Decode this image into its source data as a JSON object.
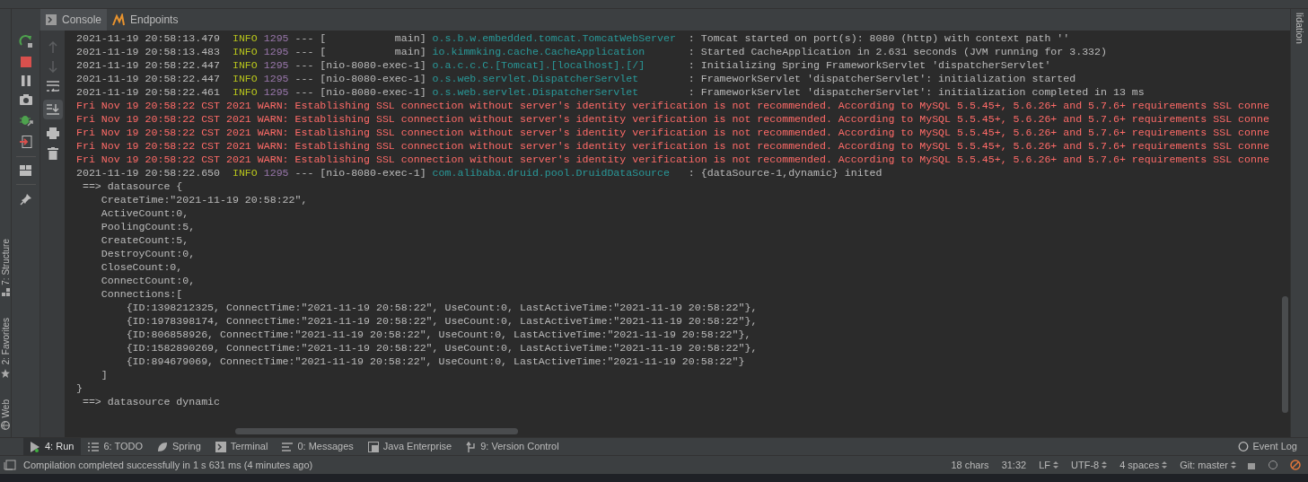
{
  "console_tabs": [
    {
      "label": "Console",
      "selected": true
    },
    {
      "label": "Endpoints",
      "selected": false
    }
  ],
  "side_tabs": [
    {
      "label": "7: Structure"
    },
    {
      "label": "2: Favorites"
    },
    {
      "label": "Web"
    }
  ],
  "right_tab": "lidation",
  "log_lines": [
    {
      "kind": "info",
      "timestamp": "2021-11-19 20:58:13.479",
      "level": "INFO",
      "pid": "1295",
      "sep": "---",
      "thread": "[           main]",
      "logger": "o.s.b.w.embedded.tomcat.TomcatWebServer",
      "message": ": Tomcat started on port(s): 8080 (http) with context path ''"
    },
    {
      "kind": "info",
      "timestamp": "2021-11-19 20:58:13.483",
      "level": "INFO",
      "pid": "1295",
      "sep": "---",
      "thread": "[           main]",
      "logger": "io.kimmking.cache.CacheApplication",
      "message": ": Started CacheApplication in 2.631 seconds (JVM running for 3.332)"
    },
    {
      "kind": "info",
      "timestamp": "2021-11-19 20:58:22.447",
      "level": "INFO",
      "pid": "1295",
      "sep": "---",
      "thread": "[nio-8080-exec-1]",
      "logger": "o.a.c.c.C.[Tomcat].[localhost].[/]",
      "message": ": Initializing Spring FrameworkServlet 'dispatcherServlet'"
    },
    {
      "kind": "info",
      "timestamp": "2021-11-19 20:58:22.447",
      "level": "INFO",
      "pid": "1295",
      "sep": "---",
      "thread": "[nio-8080-exec-1]",
      "logger": "o.s.web.servlet.DispatcherServlet",
      "message": ": FrameworkServlet 'dispatcherServlet': initialization started"
    },
    {
      "kind": "info",
      "timestamp": "2021-11-19 20:58:22.461",
      "level": "INFO",
      "pid": "1295",
      "sep": "---",
      "thread": "[nio-8080-exec-1]",
      "logger": "o.s.web.servlet.DispatcherServlet",
      "message": ": FrameworkServlet 'dispatcherServlet': initialization completed in 13 ms"
    },
    {
      "kind": "warn",
      "text": "Fri Nov 19 20:58:22 CST 2021 WARN: Establishing SSL connection without server's identity verification is not recommended. According to MySQL 5.5.45+, 5.6.26+ and 5.7.6+ requirements SSL conne"
    },
    {
      "kind": "warn",
      "text": "Fri Nov 19 20:58:22 CST 2021 WARN: Establishing SSL connection without server's identity verification is not recommended. According to MySQL 5.5.45+, 5.6.26+ and 5.7.6+ requirements SSL conne"
    },
    {
      "kind": "warn",
      "text": "Fri Nov 19 20:58:22 CST 2021 WARN: Establishing SSL connection without server's identity verification is not recommended. According to MySQL 5.5.45+, 5.6.26+ and 5.7.6+ requirements SSL conne"
    },
    {
      "kind": "warn",
      "text": "Fri Nov 19 20:58:22 CST 2021 WARN: Establishing SSL connection without server's identity verification is not recommended. According to MySQL 5.5.45+, 5.6.26+ and 5.7.6+ requirements SSL conne"
    },
    {
      "kind": "warn",
      "text": "Fri Nov 19 20:58:22 CST 2021 WARN: Establishing SSL connection without server's identity verification is not recommended. According to MySQL 5.5.45+, 5.6.26+ and 5.7.6+ requirements SSL conne"
    },
    {
      "kind": "info",
      "timestamp": "2021-11-19 20:58:22.650",
      "level": "INFO",
      "pid": "1295",
      "sep": "---",
      "thread": "[nio-8080-exec-1]",
      "logger": "com.alibaba.druid.pool.DruidDataSource",
      "message": ": {dataSource-1,dynamic} inited"
    },
    {
      "kind": "plain",
      "text": " ==> datasource {"
    },
    {
      "kind": "plain",
      "text": "    CreateTime:\"2021-11-19 20:58:22\","
    },
    {
      "kind": "plain",
      "text": "    ActiveCount:0,"
    },
    {
      "kind": "plain",
      "text": "    PoolingCount:5,"
    },
    {
      "kind": "plain",
      "text": "    CreateCount:5,"
    },
    {
      "kind": "plain",
      "text": "    DestroyCount:0,"
    },
    {
      "kind": "plain",
      "text": "    CloseCount:0,"
    },
    {
      "kind": "plain",
      "text": "    ConnectCount:0,"
    },
    {
      "kind": "plain",
      "text": "    Connections:["
    },
    {
      "kind": "plain",
      "text": "        {ID:1398212325, ConnectTime:\"2021-11-19 20:58:22\", UseCount:0, LastActiveTime:\"2021-11-19 20:58:22\"},"
    },
    {
      "kind": "plain",
      "text": "        {ID:1978398174, ConnectTime:\"2021-11-19 20:58:22\", UseCount:0, LastActiveTime:\"2021-11-19 20:58:22\"},"
    },
    {
      "kind": "plain",
      "text": "        {ID:806858926, ConnectTime:\"2021-11-19 20:58:22\", UseCount:0, LastActiveTime:\"2021-11-19 20:58:22\"},"
    },
    {
      "kind": "plain",
      "text": "        {ID:1582890269, ConnectTime:\"2021-11-19 20:58:22\", UseCount:0, LastActiveTime:\"2021-11-19 20:58:22\"},"
    },
    {
      "kind": "plain",
      "text": "        {ID:894679069, ConnectTime:\"2021-11-19 20:58:22\", UseCount:0, LastActiveTime:\"2021-11-19 20:58:22\"}"
    },
    {
      "kind": "plain",
      "text": "    ]"
    },
    {
      "kind": "plain",
      "text": "}"
    },
    {
      "kind": "plain",
      "text": " ==> datasource dynamic"
    }
  ],
  "tool_tabs": [
    {
      "label": "4: Run",
      "selected": true
    },
    {
      "label": "6: TODO",
      "selected": false
    },
    {
      "label": "Spring",
      "selected": false
    },
    {
      "label": "Terminal",
      "selected": false
    },
    {
      "label": "0: Messages",
      "selected": false
    },
    {
      "label": "Java Enterprise",
      "selected": false
    },
    {
      "label": "9: Version Control",
      "selected": false
    }
  ],
  "event_log": "Event Log",
  "status_bar": {
    "message": "Compilation completed successfully in 1 s 631 ms (4 minutes ago)",
    "items": [
      {
        "label": "18 chars",
        "dropdown": false
      },
      {
        "label": "31:32",
        "dropdown": false
      },
      {
        "label": "LF",
        "dropdown": true
      },
      {
        "label": "UTF-8",
        "dropdown": true
      },
      {
        "label": "4 spaces",
        "dropdown": true
      },
      {
        "label": "Git: master",
        "dropdown": true
      }
    ]
  }
}
